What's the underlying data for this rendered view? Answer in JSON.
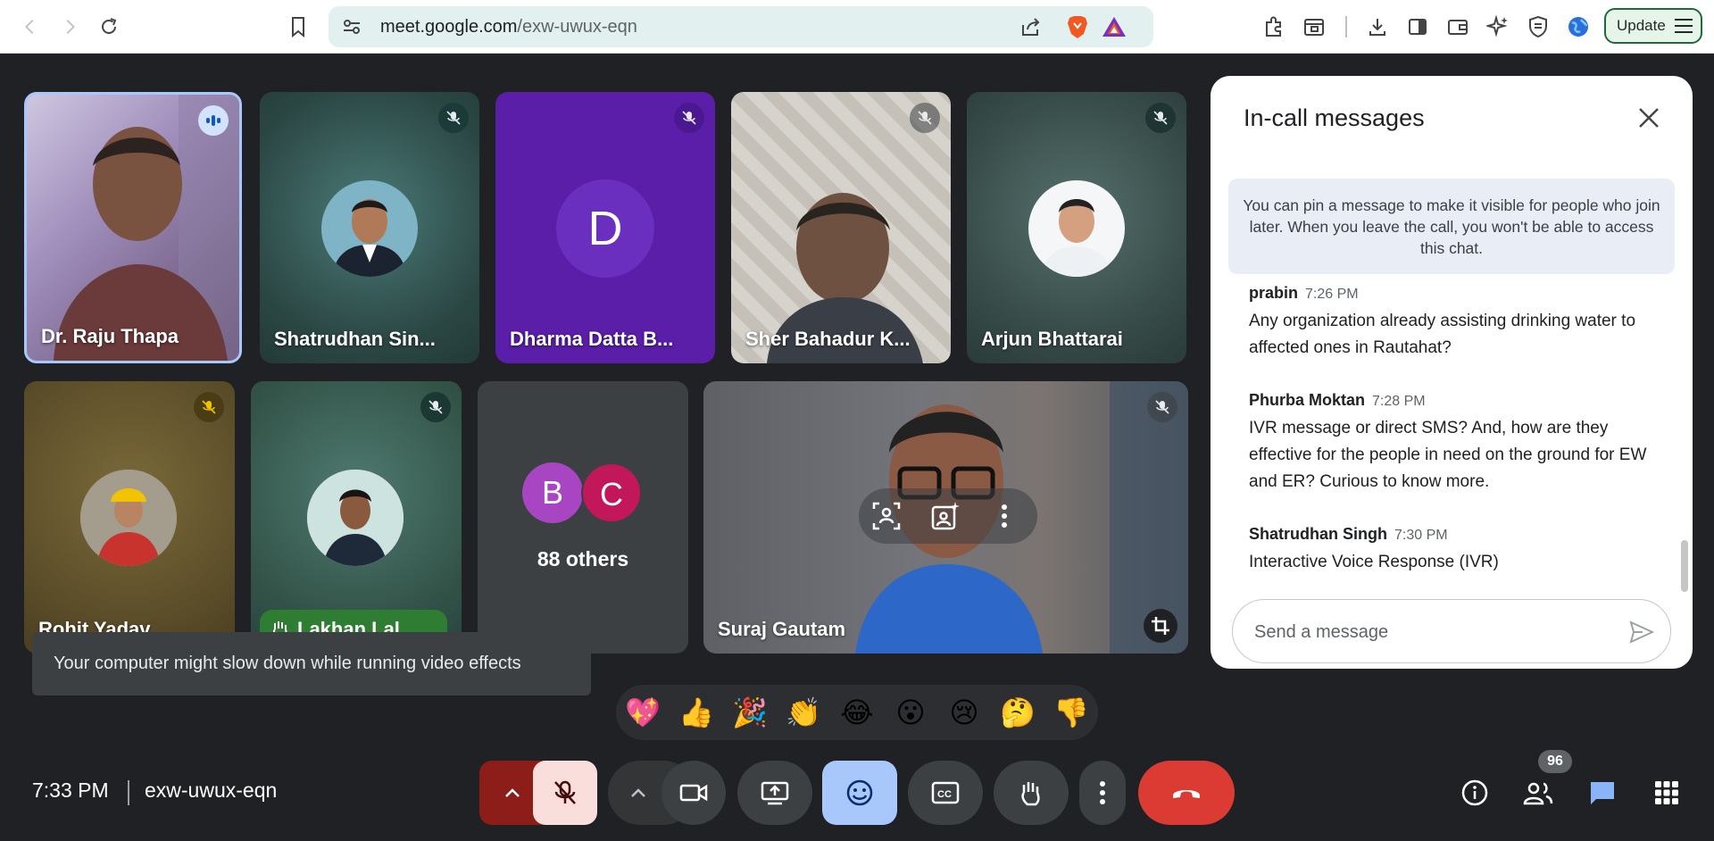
{
  "browser": {
    "url_host": "meet.google.com",
    "url_path": "/exw-uwux-eqn",
    "update_label": "Update"
  },
  "tiles": [
    {
      "name": "Dr. Raju Thapa"
    },
    {
      "name": "Shatrudhan Sin..."
    },
    {
      "name": "Dharma Datta B...",
      "initial": "D"
    },
    {
      "name": "Sher Bahadur K..."
    },
    {
      "name": "Arjun Bhattarai"
    },
    {
      "name": "Rohit Yadav"
    },
    {
      "name": "Lakhan Lal..."
    },
    {
      "name": "Suraj Gautam"
    }
  ],
  "others": {
    "initials": [
      "B",
      "C"
    ],
    "label": "88 others"
  },
  "toast": "Your computer might slow down while running video effects",
  "chat": {
    "title": "In-call messages",
    "pin_note": "You can pin a message to make it visible for people who join later. When you leave the call, you won't be able to access this chat.",
    "messages": [
      {
        "sender": "prabin",
        "time": "7:26 PM",
        "text": "Any organization already assisting drinking water to affected ones in Rautahat?"
      },
      {
        "sender": "Phurba Moktan",
        "time": "7:28 PM",
        "text": "IVR message or direct SMS? And, how are they effective for the people in need on the ground for EW and ER? Curious to know more."
      },
      {
        "sender": "Shatrudhan Singh",
        "time": "7:30 PM",
        "text": "Interactive Voice Response (IVR)"
      }
    ],
    "input_placeholder": "Send a message"
  },
  "reactions": [
    "💖",
    "👍",
    "🎉",
    "👏",
    "😂",
    "😮",
    "😢",
    "🤔",
    "👎"
  ],
  "bottom": {
    "time": "7:33 PM",
    "meeting_code": "exw-uwux-eqn",
    "participant_count": "96"
  },
  "colors": {
    "accent_blue": "#a8c7fa",
    "end_call_red": "#dc3b34",
    "mic_off_bg": "#f9dedc",
    "dharma_tile": "#5b1ea8"
  }
}
